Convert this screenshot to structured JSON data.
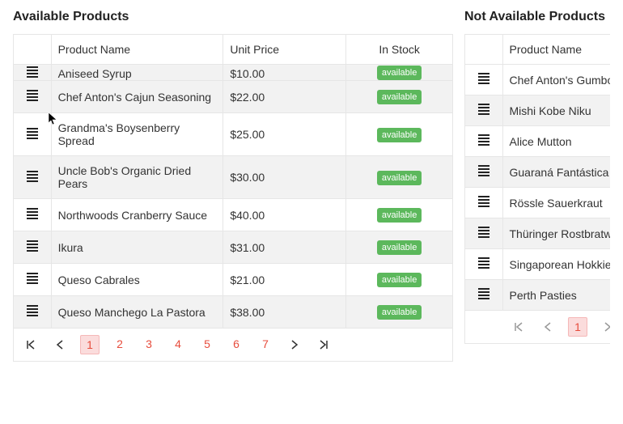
{
  "left": {
    "title": "Available Products",
    "headers": {
      "name": "Product Name",
      "price": "Unit Price",
      "stock": "In Stock"
    },
    "badge_label": "available",
    "rows": [
      {
        "name": "Aniseed Syrup",
        "price": "$10.00",
        "alt": true,
        "clipped": true
      },
      {
        "name": "Chef Anton's Cajun Seasoning",
        "price": "$22.00",
        "alt": true
      },
      {
        "name": "Grandma's Boysenberry Spread",
        "price": "$25.00",
        "alt": false
      },
      {
        "name": "Uncle Bob's Organic Dried Pears",
        "price": "$30.00",
        "alt": true
      },
      {
        "name": "Northwoods Cranberry Sauce",
        "price": "$40.00",
        "alt": false
      },
      {
        "name": "Ikura",
        "price": "$31.00",
        "alt": true
      },
      {
        "name": "Queso Cabrales",
        "price": "$21.00",
        "alt": false
      },
      {
        "name": "Queso Manchego La Pastora",
        "price": "$38.00",
        "alt": true
      }
    ],
    "pager": {
      "pages": [
        "1",
        "2",
        "3",
        "4",
        "5",
        "6",
        "7"
      ],
      "active": 0
    }
  },
  "right": {
    "title": "Not Available Products",
    "headers": {
      "name": "Product Name"
    },
    "rows": [
      {
        "name": "Chef Anton's Gumbo Mix",
        "alt": false
      },
      {
        "name": "Mishi Kobe Niku",
        "alt": true
      },
      {
        "name": "Alice Mutton",
        "alt": false
      },
      {
        "name": "Guaraná Fantástica",
        "alt": true
      },
      {
        "name": "Rössle Sauerkraut",
        "alt": false
      },
      {
        "name": "Thüringer Rostbratwurst",
        "alt": true
      },
      {
        "name": "Singaporean Hokkien Fried Mee",
        "alt": false
      },
      {
        "name": "Perth Pasties",
        "alt": true
      }
    ],
    "pager": {
      "pages": [
        "1"
      ],
      "active": 0
    }
  }
}
